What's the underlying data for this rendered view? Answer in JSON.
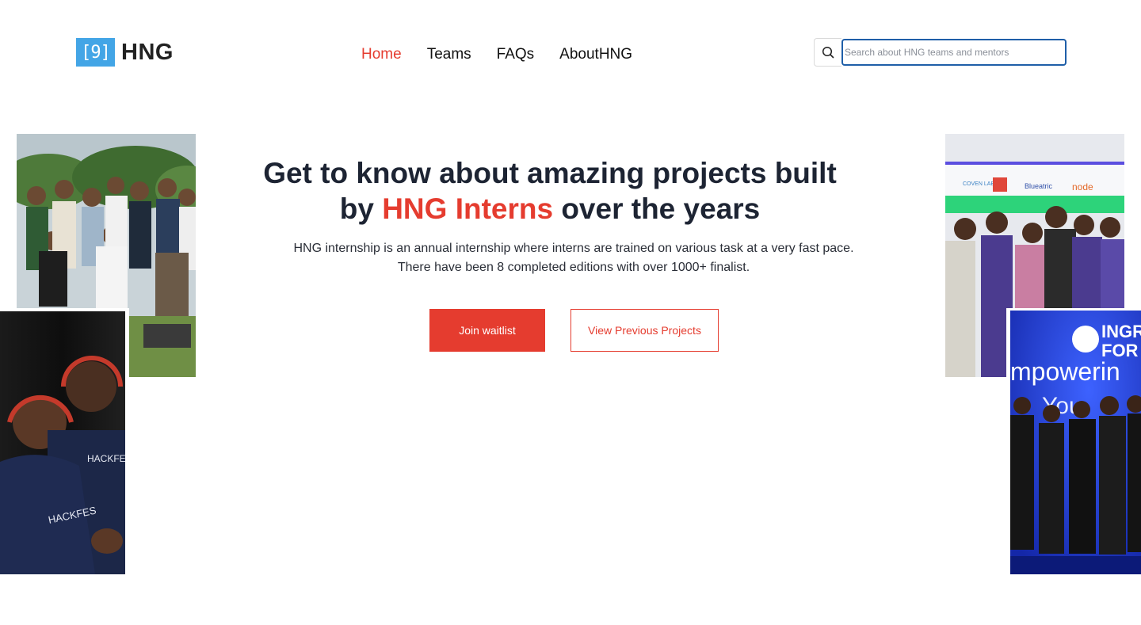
{
  "brand": {
    "logo_mark": "[9]",
    "name": "HNG"
  },
  "nav": {
    "items": [
      {
        "label": "Home",
        "active": true
      },
      {
        "label": "Teams",
        "active": false
      },
      {
        "label": "FAQs",
        "active": false
      },
      {
        "label": "AboutHNG",
        "active": false
      }
    ]
  },
  "search": {
    "icon": "search-icon",
    "placeholder": "Search about HNG teams and mentors",
    "value": ""
  },
  "hero": {
    "title_part1": "Get to know about amazing projects built by ",
    "title_accent": "HNG Interns",
    "title_part2": " over the years",
    "description": "HNG internship is an annual internship where interns are trained on various task at a very fast pace. There have been 8 completed editions with over 1000+ finalist.",
    "primary_button": "Join waitlist",
    "secondary_button": "View Previous Projects"
  },
  "photo_text": {
    "banner_logos": [
      "COVEN LABS",
      "Blueatric",
      "node"
    ],
    "stage_title_1": "INGR",
    "stage_title_2": "FOR",
    "stage_slogan": "mpowerin",
    "stage_slogan_2": "You",
    "tshirt": "HACKFES"
  },
  "colors": {
    "accent": "#e53c2f",
    "logo_blue": "#43a5e6",
    "search_border": "#1f5fa8",
    "heading": "#1d2433"
  }
}
